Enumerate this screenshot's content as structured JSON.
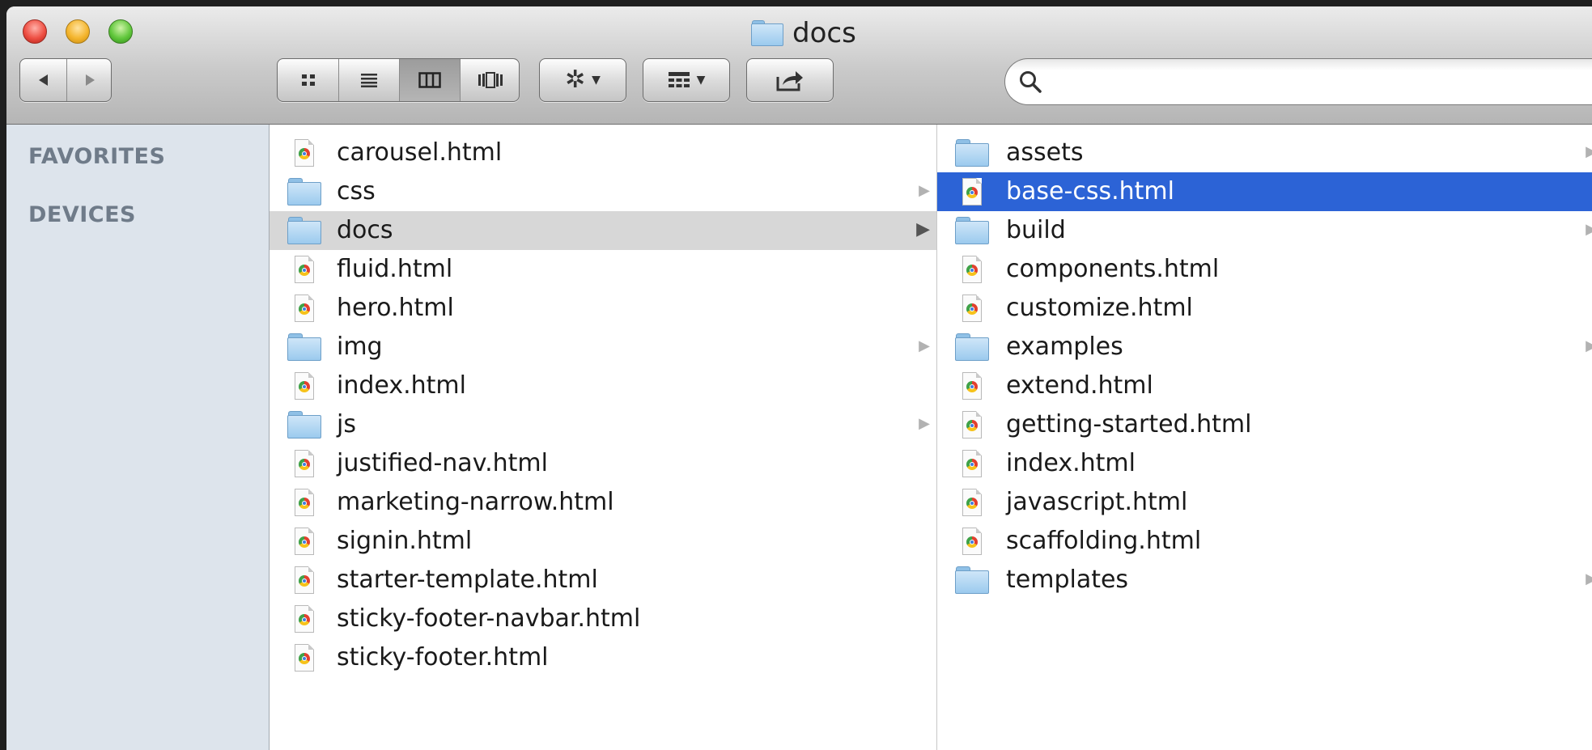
{
  "window": {
    "title": "docs"
  },
  "toolbar": {
    "back_icon": "back-arrow-icon",
    "forward_icon": "forward-arrow-icon",
    "view_modes": [
      "icon-view-icon",
      "list-view-icon",
      "column-view-icon",
      "cover-flow-icon"
    ],
    "active_view": "column",
    "action_icon": "gear-icon",
    "arrange_icon": "arrange-grid-icon",
    "share_icon": "share-icon",
    "search": {
      "placeholder": "",
      "value": ""
    }
  },
  "sidebar": {
    "sections": [
      "FAVORITES",
      "DEVICES"
    ]
  },
  "column1": {
    "items": [
      {
        "name": "carousel.html",
        "type": "file"
      },
      {
        "name": "css",
        "type": "folder"
      },
      {
        "name": "docs",
        "type": "folder",
        "selected": true
      },
      {
        "name": "fluid.html",
        "type": "file"
      },
      {
        "name": "hero.html",
        "type": "file"
      },
      {
        "name": "img",
        "type": "folder"
      },
      {
        "name": "index.html",
        "type": "file"
      },
      {
        "name": "js",
        "type": "folder"
      },
      {
        "name": "justified-nav.html",
        "type": "file"
      },
      {
        "name": "marketing-narrow.html",
        "type": "file"
      },
      {
        "name": "signin.html",
        "type": "file"
      },
      {
        "name": "starter-template.html",
        "type": "file"
      },
      {
        "name": "sticky-footer-navbar.html",
        "type": "file"
      },
      {
        "name": "sticky-footer.html",
        "type": "file"
      }
    ]
  },
  "column2": {
    "items": [
      {
        "name": "assets",
        "type": "folder"
      },
      {
        "name": "base-css.html",
        "type": "file",
        "selected": true
      },
      {
        "name": "build",
        "type": "folder"
      },
      {
        "name": "components.html",
        "type": "file"
      },
      {
        "name": "customize.html",
        "type": "file"
      },
      {
        "name": "examples",
        "type": "folder"
      },
      {
        "name": "extend.html",
        "type": "file"
      },
      {
        "name": "getting-started.html",
        "type": "file"
      },
      {
        "name": "index.html",
        "type": "file"
      },
      {
        "name": "javascript.html",
        "type": "file"
      },
      {
        "name": "scaffolding.html",
        "type": "file"
      },
      {
        "name": "templates",
        "type": "folder"
      }
    ]
  },
  "colors": {
    "selection_blue": "#2c63d6",
    "selection_gray": "#d7d7d7",
    "sidebar_bg": "#dde4ec"
  }
}
